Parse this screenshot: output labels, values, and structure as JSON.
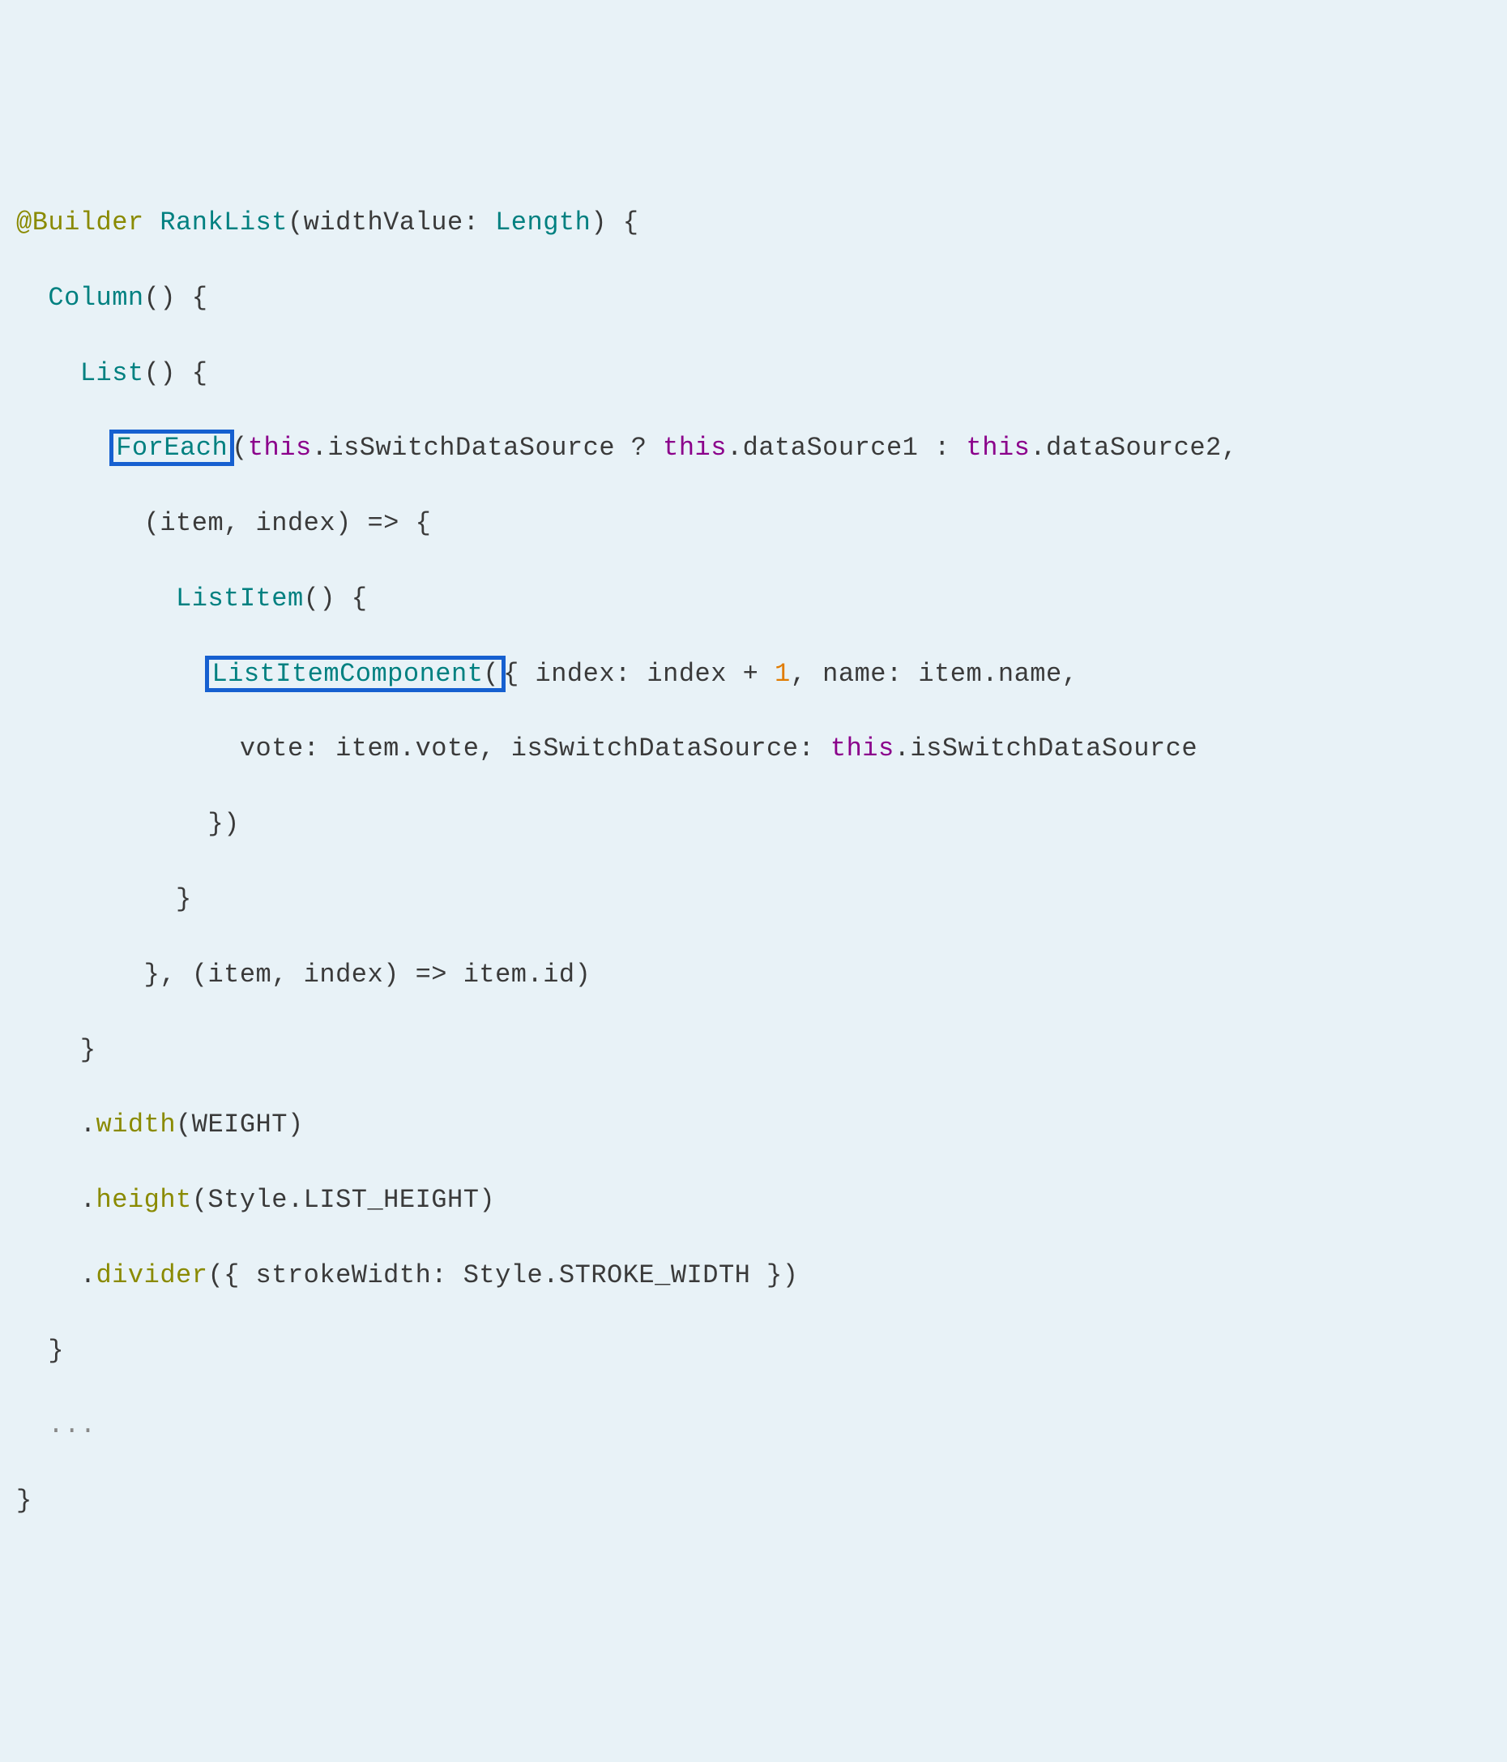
{
  "code": {
    "line1": {
      "decorator": "@Builder",
      "funcName": "RankList",
      "paramName": "widthValue",
      "paramType": "Length"
    },
    "line2": {
      "call": "Column"
    },
    "line3": {
      "call": "List"
    },
    "line4": {
      "forEach": "ForEach",
      "thisRef1": "this",
      "prop1": ".isSwitchDataSource ? ",
      "thisRef2": "this",
      "prop2": ".dataSource1 : ",
      "thisRef3": "this",
      "prop3": ".dataSource2,"
    },
    "line5": {
      "params": "(item, index) => {"
    },
    "line6": {
      "call": "ListItem"
    },
    "line7": {
      "component": "ListItemComponent",
      "openBrace": "{",
      "text1": " index: index + ",
      "num": "1",
      "text2": ", name: item.name,"
    },
    "line8": {
      "text1": "vote: item.vote, isSwitchDataSource: ",
      "thisRef": "this",
      "text2": ".isSwitchDataSource"
    },
    "line9": {
      "close": "})"
    },
    "line10": {
      "close": "}"
    },
    "line11": {
      "text": "}, (item, index) => item.id)"
    },
    "line12": {
      "close": "}"
    },
    "line13": {
      "method": "width",
      "arg": "WEIGHT"
    },
    "line14": {
      "method": "height",
      "argPrefix": "Style",
      "argSuffix": ".LIST_HEIGHT"
    },
    "line15": {
      "method": "divider",
      "argText1": "{ strokeWidth: ",
      "argPrefix": "Style",
      "argText2": ".STROKE_WIDTH }"
    },
    "line16": {
      "close": "}"
    },
    "line17": {
      "ellipsis": "..."
    },
    "line18": {
      "close": "}"
    }
  },
  "colors": {
    "highlight": "#1660d0",
    "background": "#e8f2f7",
    "olive": "#8a8a00",
    "teal": "#008080",
    "purple": "#8b008b",
    "orange": "#e07b00"
  }
}
